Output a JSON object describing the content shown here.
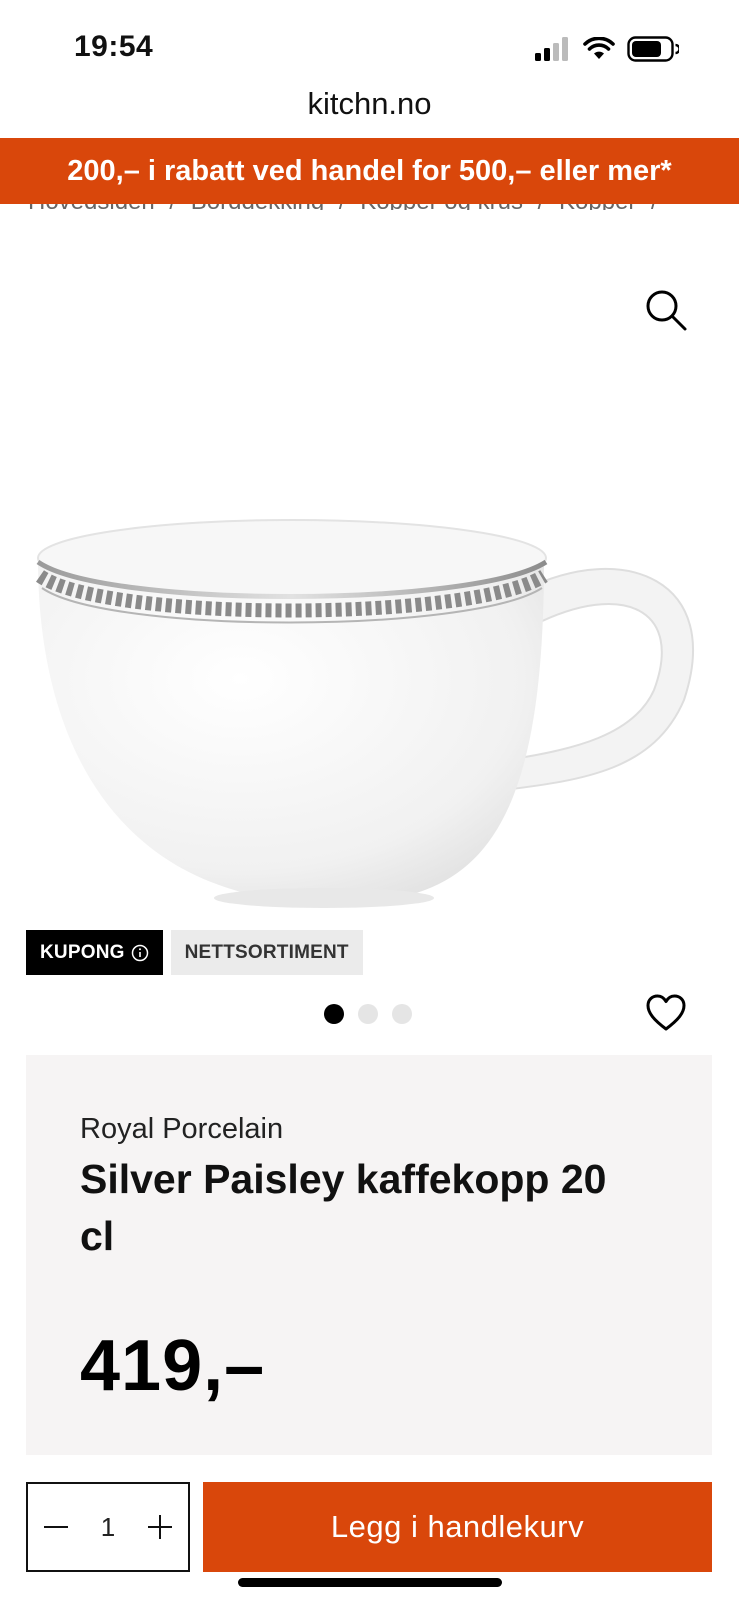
{
  "status_bar": {
    "time": "19:54",
    "icons": [
      "signal-icon",
      "wifi-icon",
      "battery-icon"
    ]
  },
  "browser": {
    "url": "kitchn.no"
  },
  "promo_banner": {
    "text": "200,– i rabatt ved handel for 500,– eller mer*"
  },
  "breadcrumb": {
    "items": [
      "Hovedsiden",
      "Borddekking",
      "Kopper og krus",
      "Kopper"
    ],
    "separator": "/"
  },
  "product": {
    "badges": {
      "kupong": "KUPONG",
      "nettsortiment": "NETTSORTIMENT"
    },
    "gallery": {
      "total_images": 3,
      "active_index": 0
    },
    "brand": "Royal Porcelain",
    "title": "Silver Paisley kaffekopp 20 cl",
    "price": "419,–"
  },
  "cart": {
    "quantity": "1",
    "add_button_label": "Legg i handlekurv"
  },
  "colors": {
    "accent": "#d9470b",
    "card_bg": "#f6f4f4",
    "badge_dark": "#000000",
    "badge_light": "#ebebeb"
  }
}
